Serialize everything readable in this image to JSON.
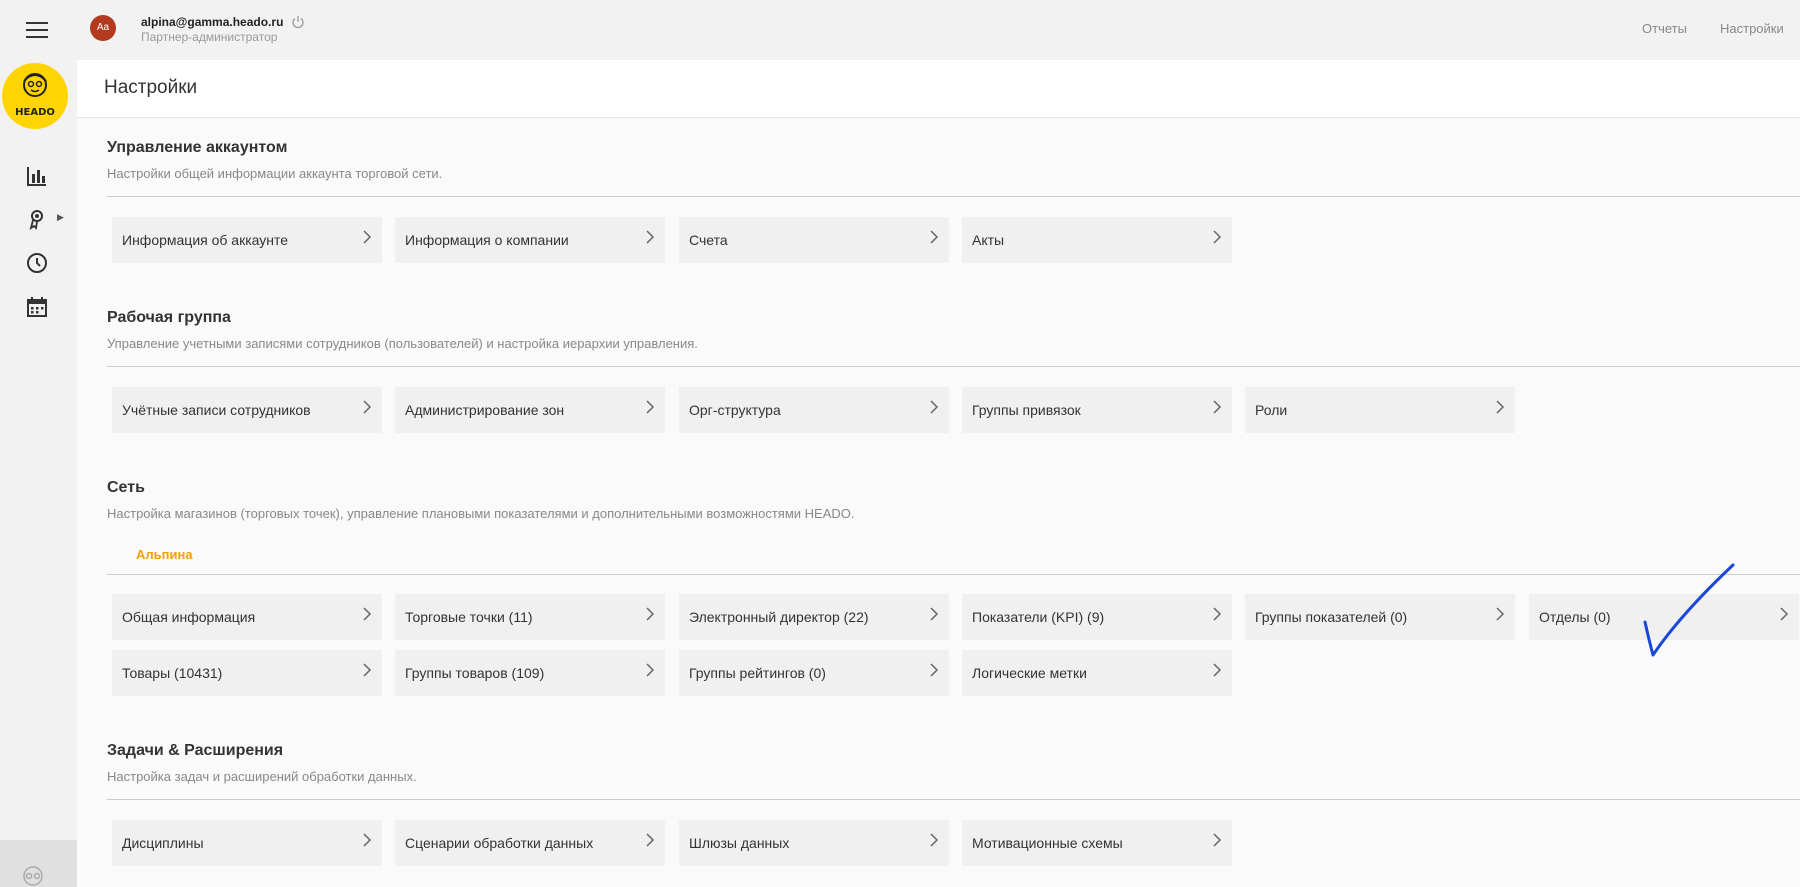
{
  "app": {
    "logo_text": "HEADO",
    "accent_color": "#ffd400",
    "highlight_color": "#f5a000"
  },
  "user": {
    "avatar_initials": "Aa",
    "email": "alpina@gamma.heado.ru",
    "role": "Партнер-администратор"
  },
  "topnav": {
    "reports": "Отчеты",
    "settings": "Настройки"
  },
  "sidebar_icons": [
    "menu-icon",
    "bar-chart-icon",
    "award-icon",
    "clock-icon",
    "calendar-icon",
    "robot-icon"
  ],
  "page": {
    "title": "Настройки"
  },
  "sections": [
    {
      "title": "Управление аккаунтом",
      "description": "Настройки общей информации аккаунта торговой сети.",
      "tiles": [
        "Информация об аккаунте",
        "Информация о компании",
        "Счета",
        "Акты"
      ]
    },
    {
      "title": "Рабочая группа",
      "description": "Управление учетными записями сотрудников (пользователей) и настройка иерархии управления.",
      "tiles": [
        "Учётные записи сотрудников",
        "Администрирование зон",
        "Орг-структура",
        "Группы привязок",
        "Роли"
      ]
    },
    {
      "title": "Сеть",
      "description": "Настройка магазинов (торговых точек), управление плановыми показателями и дополнительными возможностями HEADO.",
      "sub_tab": "Альпина",
      "tiles": [
        "Общая информация",
        "Торговые точки (11)",
        "Электронный директор (22)",
        "Показатели (KPI) (9)",
        "Группы показателей (0)",
        "Отделы (0)",
        "Товары (10431)",
        "Группы товаров (109)",
        "Группы рейтингов (0)",
        "Логические метки"
      ]
    },
    {
      "title": "Задачи & Расширения",
      "description": "Настройка задач и расширений обработки данных.",
      "tiles": [
        "Дисциплины",
        "Сценарии обработки данных",
        "Шлюзы данных",
        "Мотивационные схемы"
      ]
    }
  ]
}
